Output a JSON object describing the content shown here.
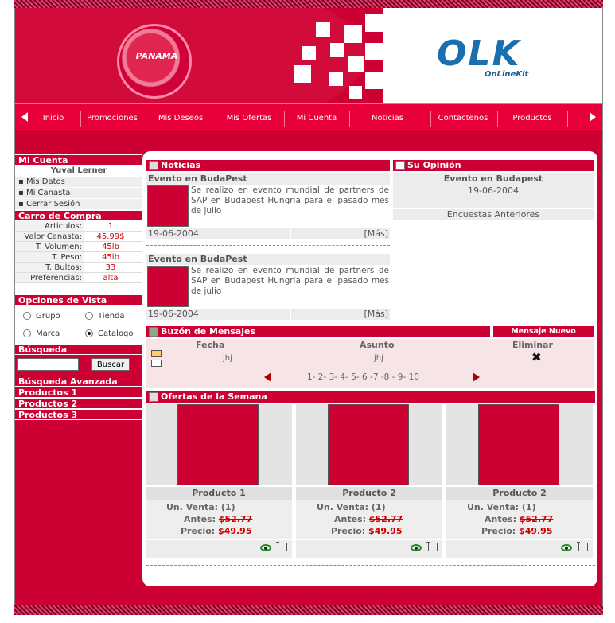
{
  "header": {
    "badge": "PANAMA",
    "logo": "OLK",
    "logo_sub": "OnLineKit"
  },
  "nav": {
    "items": [
      "Inicio",
      "Promociones",
      "Mis Deseos",
      "Mis Ofertas",
      "Mi Cuenta",
      "Noticias",
      "Contactenos",
      "Productos"
    ]
  },
  "sidebar": {
    "account_title": "Mi Cuenta",
    "user_name": "Yuval Lerner",
    "account_links": [
      "Mis Datos",
      "Mi Canasta",
      "Cerrar Sesión"
    ],
    "cart_title": "Carro de Compra",
    "cart": [
      {
        "k": "Articulos:",
        "v": "1"
      },
      {
        "k": "Valor Canasta:",
        "v": "45.99$"
      },
      {
        "k": "T. Volumen:",
        "v": "45lb"
      },
      {
        "k": "T. Peso:",
        "v": "45lb"
      },
      {
        "k": "T. Bultos:",
        "v": "33"
      },
      {
        "k": "Preferencias:",
        "v": "alta"
      }
    ],
    "view_title": "Opciones de Vista",
    "view_options": [
      "Grupo",
      "Tienda",
      "Marca",
      "Catalogo"
    ],
    "view_selected": "Catalogo",
    "search_title": "Búsqueda",
    "search_value": "",
    "search_button": "Buscar",
    "extra_links": [
      "Búsqueda Avanzada",
      "Productos 1",
      "Productos 2",
      "Productos 3"
    ]
  },
  "news": {
    "title": "Noticias",
    "items": [
      {
        "headline": "Evento en BudaPest",
        "text": "Se realizo en evento mundial de partners de SAP en Budapest Hungria para el pasado mes de julio",
        "date": "19-06-2004",
        "more": "[Más]"
      },
      {
        "headline": "Evento en BudaPest",
        "text": "Se realizo en evento mundial de partners de SAP en Budapest Hungria para el pasado mes de julio",
        "date": "19-06-2004",
        "more": "[Más]"
      }
    ]
  },
  "opinion": {
    "title": "Su Opinión",
    "headline": "Evento en Budapest",
    "date": "19-06-2004",
    "previous": "Encuestas Anteriores"
  },
  "messages": {
    "title": "Buzón de Mensajes",
    "new_button": "Mensaje Nuevo",
    "columns": [
      "Fecha",
      "Asunto",
      "Eliminar"
    ],
    "row": {
      "fecha": "jhj",
      "asunto": "jhj"
    },
    "pagination": "1- 2- 3- 4- 5- 6 -7 -8 - 9- 10"
  },
  "offers": {
    "title": "Ofertas de la Semana",
    "products": [
      {
        "name": "Producto 1",
        "unit_label": "Un. Venta:",
        "unit": "(1)",
        "before_label": "Antes:",
        "before": "$52.77",
        "price_label": "Precio:",
        "price": "$49.95"
      },
      {
        "name": "Producto 2",
        "unit_label": "Un. Venta:",
        "unit": "(1)",
        "before_label": "Antes:",
        "before": "$52.77",
        "price_label": "Precio:",
        "price": "$49.95"
      },
      {
        "name": "Producto 2",
        "unit_label": "Un. Venta:",
        "unit": "(1)",
        "before_label": "Antes:",
        "before": "$52.77",
        "price_label": "Precio:",
        "price": "$49.95"
      }
    ]
  },
  "colors": {
    "brand": "#cc0033",
    "logo": "#1a6fae"
  }
}
